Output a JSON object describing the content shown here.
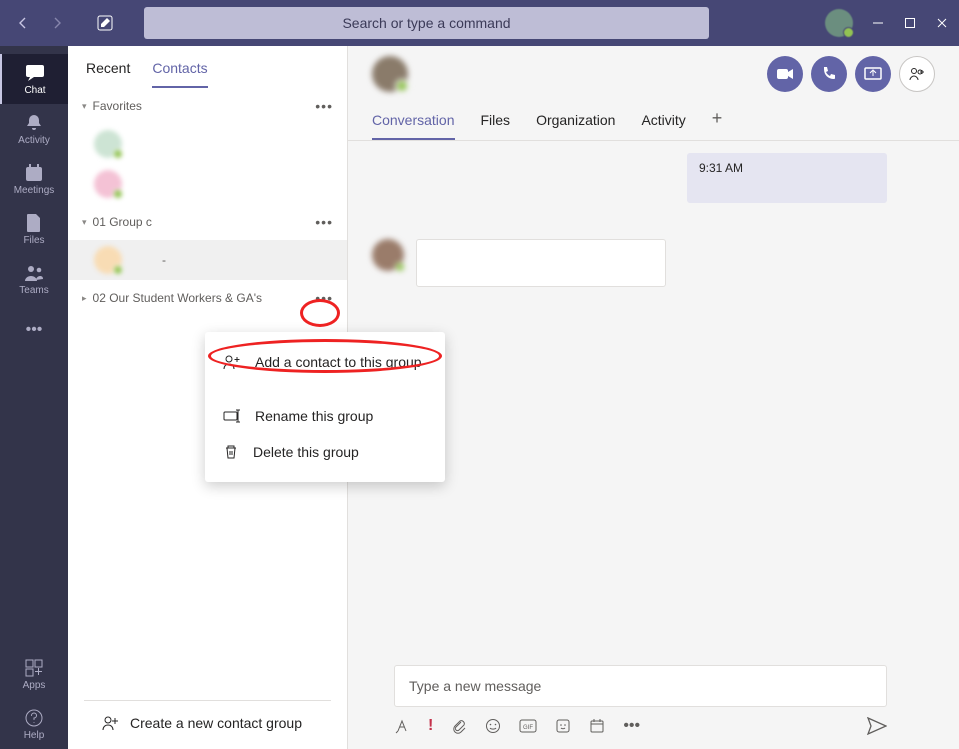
{
  "titlebar": {
    "search_placeholder": "Search or type a command"
  },
  "rail": {
    "items": [
      {
        "label": "Chat"
      },
      {
        "label": "Activity"
      },
      {
        "label": "Meetings"
      },
      {
        "label": "Files"
      },
      {
        "label": "Teams"
      }
    ],
    "bottom": [
      {
        "label": "Apps"
      },
      {
        "label": "Help"
      }
    ]
  },
  "left_pane": {
    "tabs": {
      "recent": "Recent",
      "contacts": "Contacts"
    },
    "groups": [
      {
        "name": "Favorites"
      },
      {
        "name": "01 Group c"
      },
      {
        "name": "02 Our Student Workers & GA's"
      }
    ],
    "selected_contact_label": "-",
    "create_group": "Create a new contact group"
  },
  "chat": {
    "tabs": {
      "conversation": "Conversation",
      "files": "Files",
      "organization": "Organization",
      "activity": "Activity"
    },
    "timestamp": "9:31 AM",
    "compose_placeholder": "Type a new message"
  },
  "context_menu": {
    "add": "Add a contact to this group",
    "rename": "Rename this group",
    "delete": "Delete this group"
  }
}
